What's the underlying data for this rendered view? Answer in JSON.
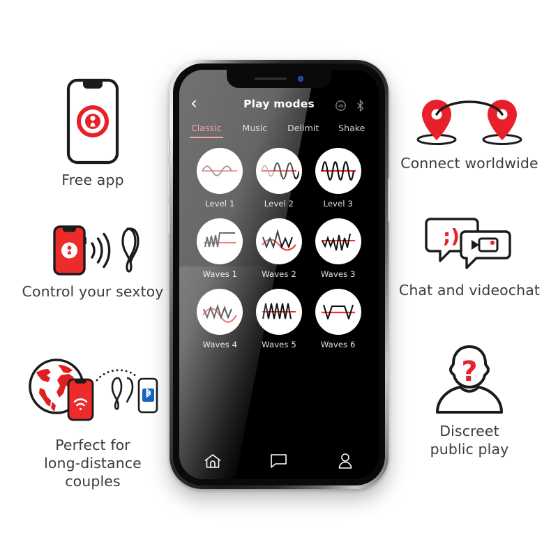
{
  "phone": {
    "appbar": {
      "back_label": "‹",
      "title": "Play modes",
      "sync_icon": "sync-icon",
      "bluetooth_icon": "bluetooth-icon"
    },
    "tabs": [
      {
        "label": "Classic",
        "active": true
      },
      {
        "label": "Music",
        "active": false
      },
      {
        "label": "Delimit",
        "active": false
      },
      {
        "label": "Shake",
        "active": false
      }
    ],
    "modes": [
      {
        "label": "Level 1",
        "icon": "wave-level-1"
      },
      {
        "label": "Level 2",
        "icon": "wave-level-2"
      },
      {
        "label": "Level 3",
        "icon": "wave-level-3"
      },
      {
        "label": "Waves 1",
        "icon": "wave-pattern-1"
      },
      {
        "label": "Waves 2",
        "icon": "wave-pattern-2"
      },
      {
        "label": "Waves 3",
        "icon": "wave-pattern-3"
      },
      {
        "label": "Waves 4",
        "icon": "wave-pattern-4"
      },
      {
        "label": "Waves 5",
        "icon": "wave-pattern-5"
      },
      {
        "label": "Waves 6",
        "icon": "wave-pattern-6"
      }
    ],
    "tabbar": [
      {
        "icon": "home-icon",
        "name": "home"
      },
      {
        "icon": "chat-bubble-icon",
        "name": "messages"
      },
      {
        "icon": "person-icon",
        "name": "profile"
      }
    ]
  },
  "features_left": [
    {
      "caption": "Free app",
      "icon": "phone-with-app-logo-icon"
    },
    {
      "caption": "Control your sextoy",
      "icon": "phone-signal-toy-icon"
    },
    {
      "caption": "Perfect for\nlong-distance\ncouples",
      "icon": "globe-phone-toy-bluetooth-icon"
    }
  ],
  "features_right": [
    {
      "caption": "Connect worldwide",
      "icon": "two-map-pins-arc-icon"
    },
    {
      "caption": "Chat and videochat",
      "icon": "speech-bubbles-video-icon"
    },
    {
      "caption": "Discreet\npublic play",
      "icon": "anonymous-person-question-icon"
    }
  ],
  "captions": {
    "free_app": "Free app",
    "control": "Control your sextoy",
    "distance_1": "Perfect for",
    "distance_2": "long-distance",
    "distance_3": "couples",
    "connect": "Connect worldwide",
    "chat": "Chat and videochat",
    "discreet_1": "Discreet",
    "discreet_2": "public play"
  },
  "colors": {
    "brand_red": "#E8202A",
    "accent_pink": "#F4626D",
    "bluetooth_blue": "#1E7FD4",
    "text_gray": "#3C3C3C",
    "screen_black": "#000000"
  }
}
